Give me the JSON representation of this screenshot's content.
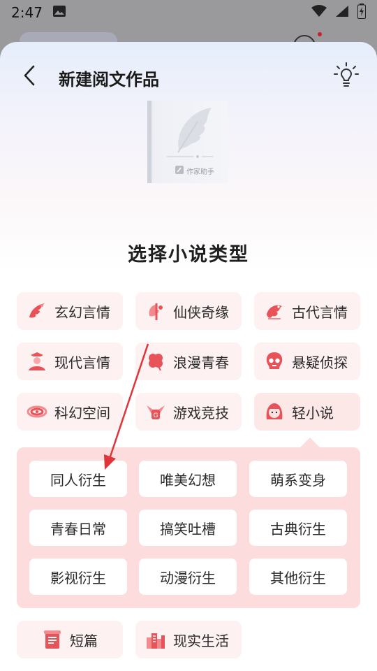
{
  "status_bar": {
    "time": "2:47",
    "icons": [
      "image-icon",
      "wifi-icon",
      "signal-icon",
      "battery-charging-icon"
    ]
  },
  "header": {
    "title": "新建阅文作品",
    "back_icon": "chevron-left-icon",
    "tip_icon": "lightbulb-icon"
  },
  "book_cover": {
    "label": "作家助手"
  },
  "section_title": "选择小说类型",
  "genres": [
    {
      "label": "玄幻言情",
      "icon": "phoenix-icon"
    },
    {
      "label": "仙侠奇缘",
      "icon": "immortal-icon"
    },
    {
      "label": "古代言情",
      "icon": "dragon-icon"
    },
    {
      "label": "现代言情",
      "icon": "woman-icon"
    },
    {
      "label": "浪漫青春",
      "icon": "clover-icon"
    },
    {
      "label": "悬疑侦探",
      "icon": "skull-icon"
    },
    {
      "label": "科幻空间",
      "icon": "galaxy-icon"
    },
    {
      "label": "游戏竞技",
      "icon": "game-wings-icon"
    },
    {
      "label": "轻小说",
      "icon": "anime-girl-icon",
      "selected": true
    },
    {
      "label": "短篇",
      "icon": "scroll-icon"
    },
    {
      "label": "现实生活",
      "icon": "city-icon"
    }
  ],
  "subgenres": [
    {
      "label": "同人衍生"
    },
    {
      "label": "唯美幻想"
    },
    {
      "label": "萌系变身"
    },
    {
      "label": "青春日常"
    },
    {
      "label": "搞笑吐槽"
    },
    {
      "label": "古典衍生"
    },
    {
      "label": "影视衍生"
    },
    {
      "label": "动漫衍生"
    },
    {
      "label": "其他衍生"
    }
  ],
  "colors": {
    "accent": "#e8535a",
    "genre_bg": "#fdf1f1",
    "subpanel_bg": "#fcdcdc",
    "annotation_arrow": "#e0343a"
  }
}
